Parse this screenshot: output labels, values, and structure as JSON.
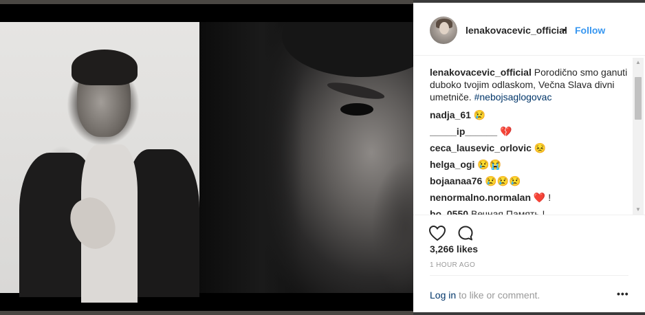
{
  "post": {
    "username": "lenakovacevic_official",
    "separator": "•",
    "follow_label": "Follow",
    "caption_text": "Porodično smo ganuti duboko tvojim odlaskom, Večna Slava divni umetniče.",
    "caption_tag": "#nebojsaglogovac",
    "likes": "3,266 likes",
    "time": "1 HOUR AGO",
    "login_link": "Log in",
    "login_rest": "to like or comment.",
    "more": "•••"
  },
  "comments": [
    {
      "user": "nadja_61",
      "text": "😢"
    },
    {
      "user": "_____ip______",
      "text": "💔"
    },
    {
      "user": "ceca_lausevic_orlovic",
      "text": "😣"
    },
    {
      "user": "helga_ogi",
      "text": "😢😭"
    },
    {
      "user": "bojaanaa76",
      "text": "😢😢😢"
    },
    {
      "user": "nenormalno.normalan",
      "text": "❤️ !"
    },
    {
      "user": "bo_0550",
      "text": "Вечная Память !"
    }
  ],
  "icons": {
    "like": "heart-icon",
    "comment": "comment-bubble-icon",
    "more": "more-options-icon"
  },
  "colors": {
    "link": "#3897f0",
    "hashtag": "#003569",
    "text": "#262626",
    "muted": "#999999"
  }
}
